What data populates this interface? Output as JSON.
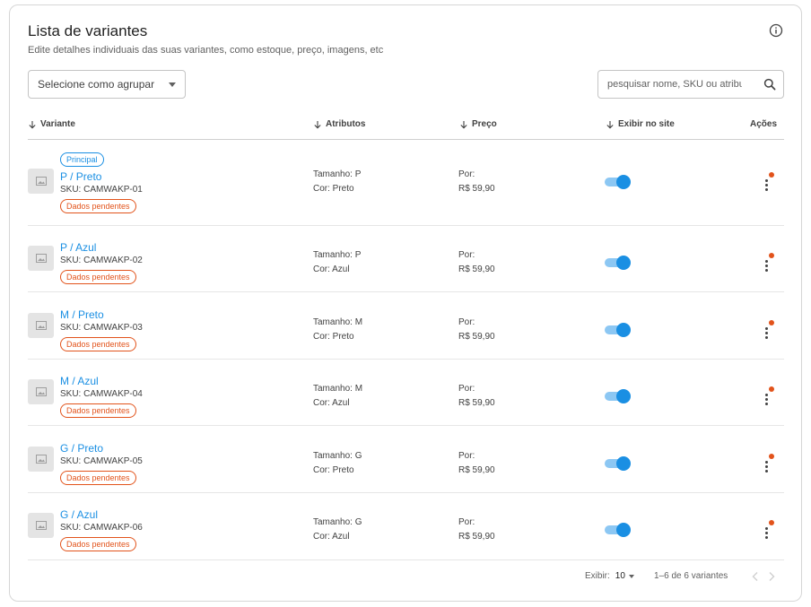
{
  "header": {
    "title": "Lista de variantes",
    "subtitle": "Edite detalhes individuais das suas variantes, como estoque, preço, imagens, etc"
  },
  "toolbar": {
    "group_select_label": "Selecione como agrupar",
    "search_placeholder": "pesquisar nome, SKU ou atributo"
  },
  "table": {
    "columns": [
      "Variante",
      "Atributos",
      "Preço",
      "Exibir no site",
      "Ações"
    ],
    "price_prefix": "Por:",
    "rows": [
      {
        "principal": "Principal",
        "name": "P / Preto",
        "sku": "SKU: CAMWAKP-01",
        "status": "Dados pendentes",
        "size": "Tamanho: P",
        "color": "Cor: Preto",
        "price": "R$ 59,90",
        "visible": true
      },
      {
        "principal": "",
        "name": "P / Azul",
        "sku": "SKU: CAMWAKP-02",
        "status": "Dados pendentes",
        "size": "Tamanho: P",
        "color": "Cor: Azul",
        "price": "R$ 59,90",
        "visible": true
      },
      {
        "principal": "",
        "name": "M / Preto",
        "sku": "SKU: CAMWAKP-03",
        "status": "Dados pendentes",
        "size": "Tamanho: M",
        "color": "Cor: Preto",
        "price": "R$ 59,90",
        "visible": true
      },
      {
        "principal": "",
        "name": "M / Azul",
        "sku": "SKU: CAMWAKP-04",
        "status": "Dados pendentes",
        "size": "Tamanho: M",
        "color": "Cor: Azul",
        "price": "R$ 59,90",
        "visible": true
      },
      {
        "principal": "",
        "name": "G / Preto",
        "sku": "SKU: CAMWAKP-05",
        "status": "Dados pendentes",
        "size": "Tamanho: G",
        "color": "Cor: Preto",
        "price": "R$ 59,90",
        "visible": true
      },
      {
        "principal": "",
        "name": "G / Azul",
        "sku": "SKU: CAMWAKP-06",
        "status": "Dados pendentes",
        "size": "Tamanho: G",
        "color": "Cor: Azul",
        "price": "R$ 59,90",
        "visible": true
      }
    ]
  },
  "pagination": {
    "per_page_label": "Exibir:",
    "per_page_value": "10",
    "range_text": "1–6 de 6 variantes"
  },
  "colors": {
    "accent": "#1a8fe3",
    "warning": "#e2531b",
    "toggle_track": "#8cc7f3"
  },
  "icons": {
    "info": "info-icon",
    "search": "search-icon",
    "sort": "arrow-down-icon",
    "image_placeholder": "image-icon",
    "actions": "more-vertical-icon",
    "prev": "chevron-left-icon",
    "next": "chevron-right-icon"
  }
}
